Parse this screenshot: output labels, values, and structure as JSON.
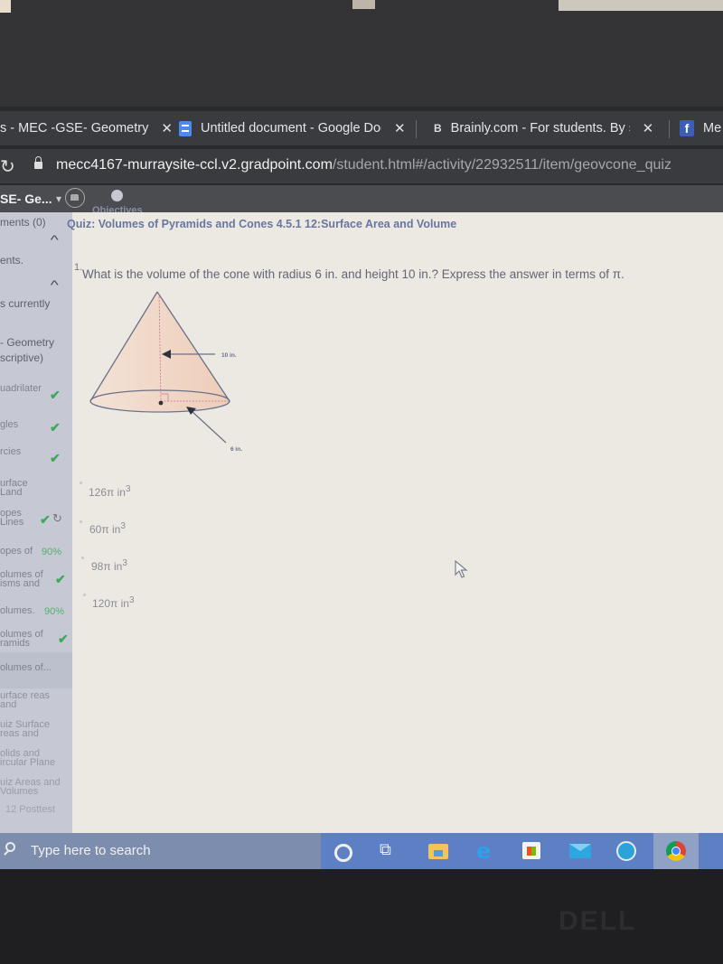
{
  "browser": {
    "tabs": [
      {
        "title": "s - MEC -GSE- Geometry",
        "icon": "page-icon",
        "close": "✕"
      },
      {
        "title": "Untitled document - Google Doc",
        "icon": "google-docs-icon",
        "close": "✕"
      },
      {
        "title": "Brainly.com - For students. By st",
        "icon": "brainly-icon",
        "icon_text": "B",
        "close": "✕"
      },
      {
        "title": "Me",
        "icon": "facebook-icon",
        "icon_text": "f"
      }
    ],
    "url_domain": "mecc4167-murraysite-ccl.v2.gradpoint.com",
    "url_path": "/student.html#/activity/22932511/item/geovcone_quiz"
  },
  "appbar": {
    "course": "SE- Ge...",
    "objectives_label": "Objectives"
  },
  "sidebar": {
    "items": [
      {
        "label": "ments (0)",
        "type": "section"
      },
      {
        "label": "ents.",
        "type": "text"
      },
      {
        "label": "s currently",
        "type": "text"
      },
      {
        "label": "- Geometry",
        "type": "text"
      },
      {
        "label": "scriptive)",
        "type": "text"
      },
      {
        "label": "uadrilater",
        "status": "complete"
      },
      {
        "label": "gles",
        "status": "complete"
      },
      {
        "label": "rcies",
        "status": "complete"
      },
      {
        "label": "urface Land",
        "status": ""
      },
      {
        "label": "opes Lines",
        "status": "complete-retry"
      },
      {
        "label": "opes of",
        "status": "score",
        "score": "90%"
      },
      {
        "label": "olumes of isms and",
        "status": "complete"
      },
      {
        "label": "olumes.",
        "status": "score",
        "score": "90%"
      },
      {
        "label": "olumes of ramids",
        "status": "complete"
      },
      {
        "label": "olumes of...",
        "status": "current"
      },
      {
        "label": "urface reas and",
        "status": ""
      },
      {
        "label": "uiz Surface reas and",
        "status": ""
      },
      {
        "label": "olids and ircular Plane",
        "status": ""
      },
      {
        "label": "uiz Areas and Volumes",
        "status": ""
      },
      {
        "label": "12 Posttest",
        "status": ""
      }
    ],
    "check_glyph": "✔",
    "retry_glyph": "↻"
  },
  "quiz": {
    "title": "Quiz: Volumes of Pyramids and Cones 4.5.1 12:Surface Area and Volume",
    "question_number": "1.",
    "question": "What is the volume of the cone with radius 6 in. and height 10 in.? Express the answer in terms of π.",
    "figure": {
      "height_label": "10 in.",
      "radius_label": "6 in."
    },
    "choices": [
      {
        "text": "126π in",
        "sup": "3"
      },
      {
        "text": "60π in",
        "sup": "3"
      },
      {
        "text": "98π in",
        "sup": "3"
      },
      {
        "text": "120π in",
        "sup": "3"
      }
    ]
  },
  "taskbar": {
    "search_placeholder": "Type here to search",
    "apps": [
      "cortana",
      "task-view",
      "file-explorer",
      "edge",
      "store",
      "mail",
      "app",
      "chrome"
    ]
  },
  "bezel": {
    "brand": "DELL"
  }
}
